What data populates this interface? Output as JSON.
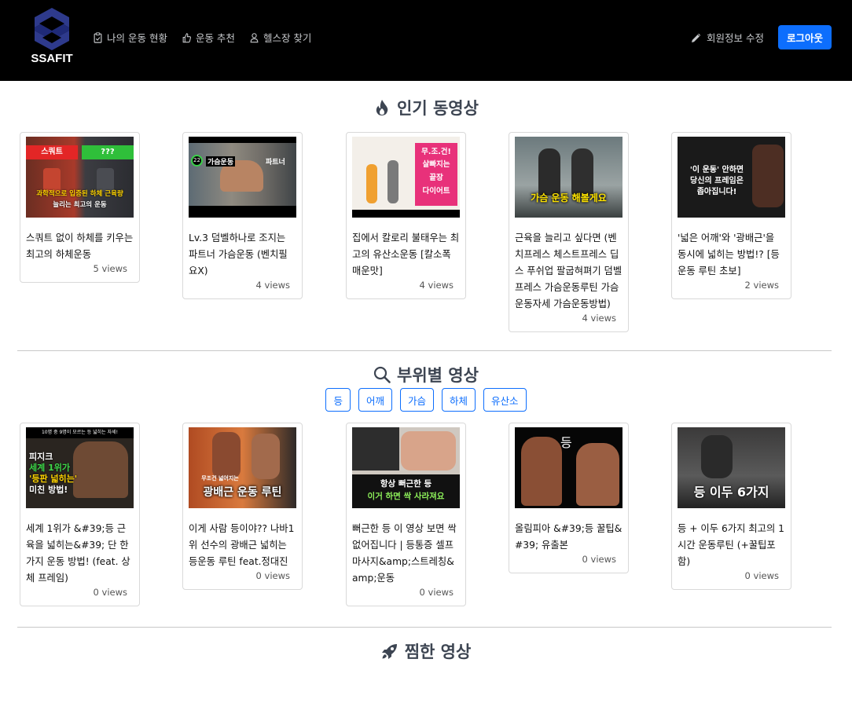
{
  "brand": {
    "name": "SSAFIT"
  },
  "nav": {
    "links": [
      {
        "label": "나의 운동 현황"
      },
      {
        "label": "운동 추천"
      },
      {
        "label": "헬스장 찾기"
      }
    ],
    "edit_profile": "회원정보 수정",
    "logout": "로그아웃"
  },
  "popular": {
    "title": "인기 동영상",
    "videos": [
      {
        "title": "스쿼트 없이 하체를 키우는 최고의 하체운동",
        "views": "5 views",
        "thumb_text": [
          "스쿼트",
          "???",
          "과학적으로 입증된 하체 근육량",
          "늘리는 최고의 운동"
        ]
      },
      {
        "title": "Lv.3 덤벨하나로 조지는 파트너 가슴운동 (벤치필요X)",
        "views": "4 views",
        "thumb_text": [
          "22",
          "가슴운동",
          "파트너"
        ]
      },
      {
        "title": "집에서 칼로리 불태우는 최고의 유산소운동 [칼소폭 매운맛]",
        "views": "4 views",
        "thumb_text": [
          "무.조.건!",
          "살빠지는",
          "끝장",
          "다이어트"
        ]
      },
      {
        "title": "근육을 늘리고 싶다면 (벤치프레스 체스트프레스 딥스 푸쉬업 팔굽혀펴기 덤벨프레스 가슴운동루틴 가슴운동자세 가슴운동방법)",
        "views": "4 views",
        "thumb_text": [
          "가슴 운동 해볼게요"
        ]
      },
      {
        "title": "'넓은 어깨'와 '광배근'을 동시에 넓히는 방법!? [등 운동 루틴 초보]",
        "views": "2 views",
        "thumb_text": [
          "'이 운동' 안하면",
          "당신의 프레임은",
          "좁아집니다!"
        ]
      }
    ]
  },
  "by_part": {
    "title": "부위별 영상",
    "filters": [
      "등",
      "어깨",
      "가슴",
      "하체",
      "유산소"
    ],
    "videos": [
      {
        "title": "세계 1위가 &#39;등 근육을 넓히는&#39; 단 한가지 운동 방법! (feat. 상체 프레임)",
        "views": "0 views",
        "thumb_text": [
          "10명 중 9명이 모르는 등 넓히는 자세!",
          "피지크",
          "세계 1위가",
          "'등판 넓히는'",
          "미친 방법!"
        ]
      },
      {
        "title": "이게 사람 등이야?? 나바1위 선수의 광배근 넓히는 등운동 루틴 feat.정대진",
        "views": "0 views",
        "thumb_text": [
          "무조건 넓어지는",
          "광배근 운동 루틴"
        ]
      },
      {
        "title": "뻐근한 등 이 영상 보면 싹 없어집니다 | 등통증 셀프 마사지&amp;스트레칭&amp;운동",
        "views": "0 views",
        "thumb_text": [
          "항상 뻐근한 등",
          "이거 하면 싹 사라져요"
        ]
      },
      {
        "title": "올림피아 &#39;등 꿀팁&#39; 유출본",
        "views": "0 views",
        "thumb_text": [
          "등"
        ]
      },
      {
        "title": "등 + 이두 6가지 최고의 1시간 운동루틴 (+꿀팁포함)",
        "views": "0 views",
        "thumb_text": [
          "등 이두 6가지"
        ]
      }
    ]
  },
  "liked": {
    "title": "찜한 영상"
  }
}
